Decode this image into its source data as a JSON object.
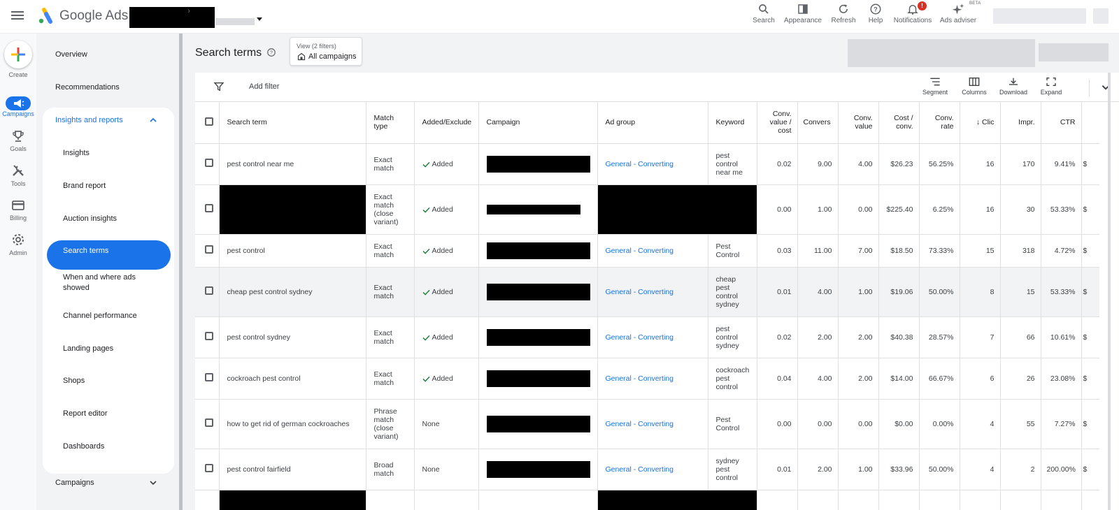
{
  "topbar": {
    "brand": "Google Ads",
    "items": [
      {
        "label": "Search",
        "icon": "search-icon"
      },
      {
        "label": "Appearance",
        "icon": "appearance-icon"
      },
      {
        "label": "Refresh",
        "icon": "refresh-icon"
      },
      {
        "label": "Help",
        "icon": "help-icon"
      },
      {
        "label": "Notifications",
        "icon": "bell-icon",
        "badge": "!"
      },
      {
        "label": "Ads adviser",
        "icon": "sparkle-icon",
        "badge": "BETA"
      }
    ]
  },
  "rail": {
    "create": "Create",
    "items": [
      {
        "label": "Campaigns",
        "icon": "megaphone-icon",
        "active": true
      },
      {
        "label": "Goals",
        "icon": "trophy-icon"
      },
      {
        "label": "Tools",
        "icon": "tools-icon"
      },
      {
        "label": "Billing",
        "icon": "card-icon"
      },
      {
        "label": "Admin",
        "icon": "gear-icon"
      }
    ]
  },
  "sidebar": {
    "overview": "Overview",
    "recommendations": "Recommendations",
    "insights_reports": "Insights and reports",
    "sub": [
      "Insights",
      "Brand report",
      "Auction insights",
      "Search terms",
      "When and where ads showed",
      "Channel performance",
      "Landing pages",
      "Shops",
      "Report editor",
      "Dashboards"
    ],
    "campaigns": "Campaigns"
  },
  "page": {
    "title": "Search terms",
    "view_filters": "View (2 filters)",
    "view_value": "All campaigns",
    "add_filter": "Add filter",
    "tools": [
      "Segment",
      "Columns",
      "Download",
      "Expand"
    ]
  },
  "table": {
    "headers": [
      "Search term",
      "Match type",
      "Added/Excluded",
      "Campaign",
      "Ad group",
      "Keyword",
      "Conv. value / cost",
      "Conversions",
      "Conv. value",
      "Cost / conv.",
      "Conv. rate",
      "Clicks",
      "Impr.",
      "CTR"
    ],
    "header_display": {
      "added": "Added/Exclude",
      "conversions": "Convers",
      "clicks": "Clic"
    },
    "rows": [
      {
        "term": "pest control near me",
        "match": "Exact match",
        "added": "Added",
        "adgroup": "General - Converting",
        "keyword": "pest control near me",
        "cvc": "0.02",
        "conv": "9.00",
        "cval": "4.00",
        "cpc": "$26.23",
        "crate": "56.25%",
        "clicks": "16",
        "impr": "170",
        "ctr": "9.41%"
      },
      {
        "term": "",
        "match": "Exact match (close variant)",
        "added": "Added",
        "adgroup": "",
        "keyword": "",
        "cvc": "0.00",
        "conv": "1.00",
        "cval": "0.00",
        "cpc": "$225.40",
        "crate": "6.25%",
        "clicks": "16",
        "impr": "30",
        "ctr": "53.33%"
      },
      {
        "term": "pest control",
        "match": "Exact match",
        "added": "Added",
        "adgroup": "General - Converting",
        "keyword": "Pest Control",
        "cvc": "0.03",
        "conv": "11.00",
        "cval": "7.00",
        "cpc": "$18.50",
        "crate": "73.33%",
        "clicks": "15",
        "impr": "318",
        "ctr": "4.72%"
      },
      {
        "term": "cheap pest control sydney",
        "match": "Exact match",
        "added": "Added",
        "adgroup": "General - Converting",
        "keyword": "cheap pest control sydney",
        "cvc": "0.01",
        "conv": "4.00",
        "cval": "1.00",
        "cpc": "$19.06",
        "crate": "50.00%",
        "clicks": "8",
        "impr": "15",
        "ctr": "53.33%"
      },
      {
        "term": "pest control sydney",
        "match": "Exact match",
        "added": "Added",
        "adgroup": "General - Converting",
        "keyword": "pest control sydney",
        "cvc": "0.02",
        "conv": "2.00",
        "cval": "2.00",
        "cpc": "$40.38",
        "crate": "28.57%",
        "clicks": "7",
        "impr": "66",
        "ctr": "10.61%"
      },
      {
        "term": "cockroach pest control",
        "match": "Exact match",
        "added": "Added",
        "adgroup": "General - Converting",
        "keyword": "cockroach pest control",
        "cvc": "0.04",
        "conv": "4.00",
        "cval": "2.00",
        "cpc": "$14.00",
        "crate": "66.67%",
        "clicks": "6",
        "impr": "26",
        "ctr": "23.08%"
      },
      {
        "term": "how to get rid of german cockroaches",
        "match": "Phrase match (close variant)",
        "added": "None",
        "adgroup": "General - Converting",
        "keyword": "Pest Control",
        "cvc": "0.00",
        "conv": "0.00",
        "cval": "0.00",
        "cpc": "$0.00",
        "crate": "0.00%",
        "clicks": "4",
        "impr": "55",
        "ctr": "7.27%"
      },
      {
        "term": "pest control fairfield",
        "match": "Broad match",
        "added": "None",
        "adgroup": "General - Converting",
        "keyword": "sydney pest control",
        "cvc": "0.01",
        "conv": "2.00",
        "cval": "1.00",
        "cpc": "$33.96",
        "crate": "50.00%",
        "clicks": "4",
        "impr": "2",
        "ctr": "200.00%"
      }
    ]
  },
  "colors": {
    "accent": "#1a73e8",
    "alert": "#d93025",
    "redaction": "#000000"
  }
}
